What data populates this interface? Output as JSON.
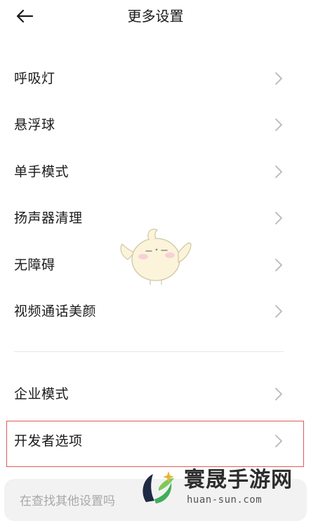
{
  "header": {
    "title": "更多设置",
    "back_icon": "arrow-left-icon"
  },
  "settings": {
    "group1": [
      {
        "label": "呼吸灯"
      },
      {
        "label": "悬浮球"
      },
      {
        "label": "单手模式"
      },
      {
        "label": "扬声器清理"
      },
      {
        "label": "无障碍"
      },
      {
        "label": "视频通话美颜"
      }
    ],
    "group2": [
      {
        "label": "企业模式"
      },
      {
        "label": "开发者选项",
        "highlighted": true
      }
    ]
  },
  "search": {
    "placeholder": "在查找其他设置吗"
  },
  "watermark": {
    "title": "寰晟手游网",
    "url": "huan-sun.com"
  },
  "colors": {
    "highlight": "#e05a5a",
    "chevron": "#b8b8b8",
    "text": "#1a1a1a",
    "search_bg": "#f2f2f2"
  }
}
